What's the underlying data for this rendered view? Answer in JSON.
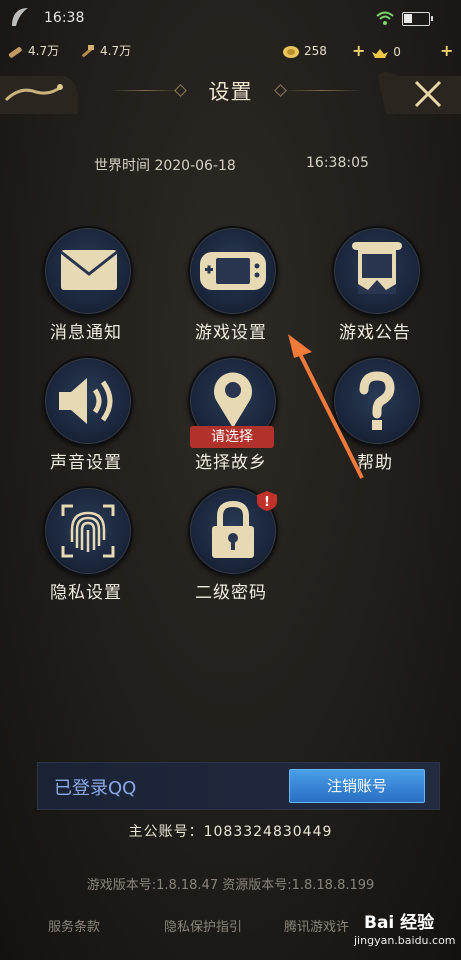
{
  "status_bar": {
    "time": "16:38"
  },
  "resources": {
    "wood": "4.7万",
    "hammer": "4.7万",
    "coins": "258",
    "ingots": "0"
  },
  "header": {
    "title": "设置"
  },
  "world_time": {
    "label": "世界时间",
    "date": "2020-06-18",
    "time": "16:38:05"
  },
  "menu": {
    "items": [
      {
        "label": "消息通知",
        "icon": "envelope-icon"
      },
      {
        "label": "游戏设置",
        "icon": "gamepad-icon"
      },
      {
        "label": "游戏公告",
        "icon": "scroll-icon"
      },
      {
        "label": "声音设置",
        "icon": "speaker-icon"
      },
      {
        "label": "选择故乡",
        "icon": "location-pin-icon",
        "tag": "请选择"
      },
      {
        "label": "帮助",
        "icon": "question-icon"
      },
      {
        "label": "隐私设置",
        "icon": "fingerprint-icon"
      },
      {
        "label": "二级密码",
        "icon": "lock-icon",
        "alert": "!"
      }
    ]
  },
  "account": {
    "login_status": "已登录QQ",
    "logout_label": "注销账号",
    "main_account_label": "主公账号：",
    "main_account_number": "1083324830449"
  },
  "version": {
    "text": "游戏版本号:1.8.18.47 资源版本号:1.8.18.8.199"
  },
  "footer": {
    "links": [
      "服务条款",
      "隐私保护指引",
      "腾讯游戏许"
    ]
  },
  "watermark": {
    "brand": "Bai 经验",
    "url": "jingyan.baidu.com"
  },
  "colors": {
    "accent_blue": "#3b8fdc",
    "tag_red": "#b0322a",
    "arrow_orange": "#f07a3a"
  }
}
